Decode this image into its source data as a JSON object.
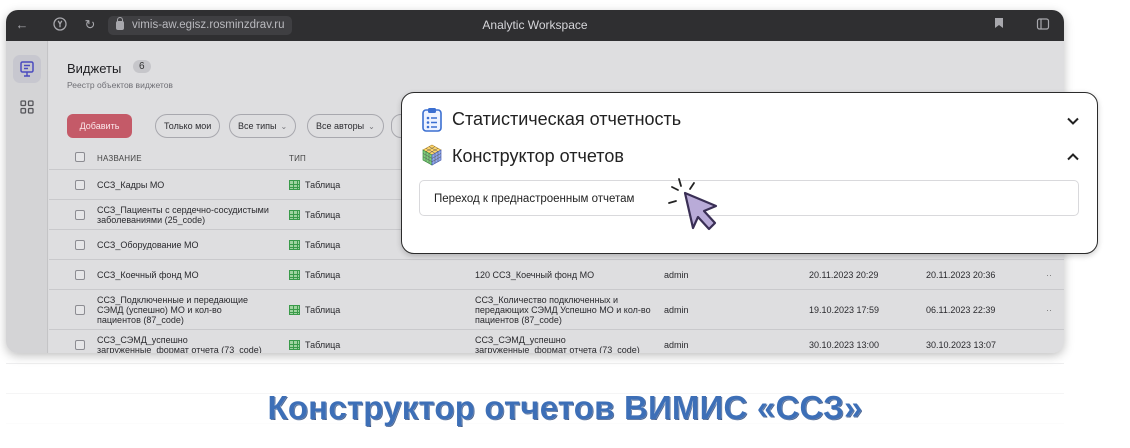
{
  "browser": {
    "url": "vimis-aw.egisz.rosminzdrav.ru",
    "window_title": "Analytic Workspace"
  },
  "header": {
    "title": "Виджеты",
    "count": "6",
    "subtitle": "Реестр объектов виджетов"
  },
  "toolbar": {
    "add_label": "Добавить",
    "filters": [
      "Только мои",
      "Все типы",
      "Все авторы"
    ]
  },
  "table": {
    "columns": {
      "name": "НАЗВАНИЕ",
      "type": "ТИП"
    },
    "rows": [
      {
        "name": "ССЗ_Кадры МО",
        "type": "Таблица",
        "desc": "",
        "author": "",
        "created": "",
        "updated": ""
      },
      {
        "name": "ССЗ_Пациенты с сердечно-сосудистыми заболеваниями (25_code)",
        "type": "Таблица",
        "desc": "",
        "author": "",
        "created": "",
        "updated": ""
      },
      {
        "name": "ССЗ_Оборудование МО",
        "type": "Таблица",
        "desc": "",
        "author": "",
        "created": "",
        "updated": ""
      },
      {
        "name": "ССЗ_Коечный фонд МО",
        "type": "Таблица",
        "desc": "120 ССЗ_Коечный фонд МО",
        "author": "admin",
        "created": "20.11.2023 20:29",
        "updated": "20.11.2023 20:36"
      },
      {
        "name": "ССЗ_Подключенные и передающие СЭМД (успешно) МО и кол-во пациентов (87_code)",
        "type": "Таблица",
        "desc": "ССЗ_Количество подключенных и передающих СЭМД Успешно МО и кол-во пациентов (87_code)",
        "author": "admin",
        "created": "19.10.2023 17:59",
        "updated": "06.11.2023 22:39"
      },
      {
        "name": "ССЗ_СЭМД_успешно загруженные_формат отчета (73_code)",
        "type": "Таблица",
        "desc": "ССЗ_СЭМД_успешно загруженные_формат отчета (73_code)",
        "author": "admin",
        "created": "30.10.2023 13:00",
        "updated": "30.10.2023 13:07"
      }
    ],
    "more": "··"
  },
  "panel": {
    "section1": "Статистическая отчетность",
    "section2": "Конструктор отчетов",
    "link": "Переход к преднастроенным отчетам"
  },
  "caption": "Конструктор отчетов ВИМИС «ССЗ»",
  "colors": {
    "accent_add": "#c45a68",
    "caption": "#3d6fb7",
    "table_icon": "#3a9a4a"
  }
}
